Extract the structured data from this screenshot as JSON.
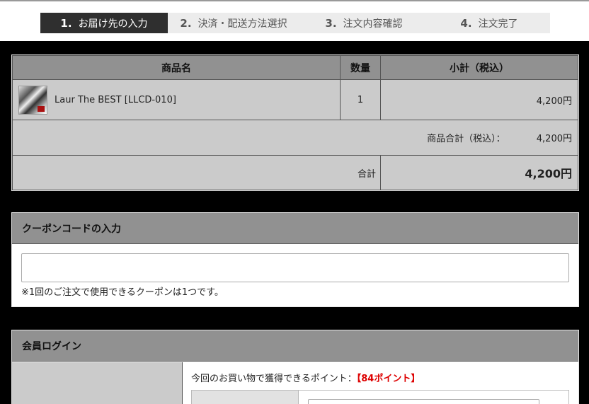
{
  "steps": [
    {
      "num": "1.",
      "label": "お届け先の入力"
    },
    {
      "num": "2.",
      "label": "決済・配送方法選択"
    },
    {
      "num": "3.",
      "label": "注文内容確認"
    },
    {
      "num": "4.",
      "label": "注文完了"
    }
  ],
  "cart": {
    "headers": {
      "name": "商品名",
      "qty": "数量",
      "subtotal": "小計（税込）"
    },
    "items": [
      {
        "name": "Laur The BEST [LLCD-010]",
        "qty": "1",
        "subtotal": "4,200円"
      }
    ],
    "items_total_label": "商品合計（税込）：",
    "items_total_value": "4,200円",
    "grand_total_label": "合計",
    "grand_total_value": "4,200円"
  },
  "coupon": {
    "title": "クーポンコードの入力",
    "input_value": "",
    "note": "※1回のご注文で使用できるクーポンは1つです。"
  },
  "login": {
    "title": "会員ログイン",
    "points_text": "今回のお買い物で獲得できるポイント：",
    "points_value": "【84ポイント】"
  },
  "colors": {
    "total": "#e00000",
    "active_step": "#2f2f2f",
    "header": "#919191"
  }
}
